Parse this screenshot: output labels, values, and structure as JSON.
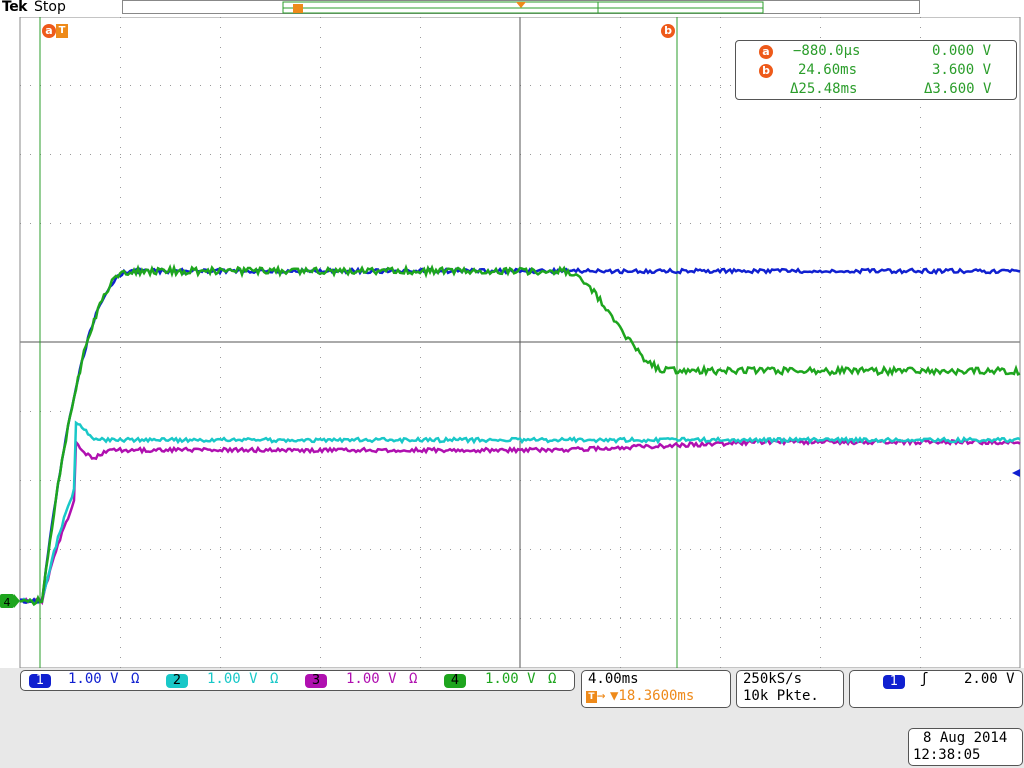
{
  "header": {
    "brand": "Tek",
    "status": "Stop"
  },
  "cursors": {
    "a_label": "a",
    "b_label": "b",
    "a_time": "−880.0µs",
    "a_volt": "0.000 V",
    "b_time": "24.60ms",
    "b_volt": "3.600 V",
    "delta_time": "Δ25.48ms",
    "delta_volt": "Δ3.600 V"
  },
  "channels": [
    {
      "num": "1",
      "scale": "1.00 V",
      "coupling": "Ω",
      "color": "#1020d0"
    },
    {
      "num": "2",
      "scale": "1.00 V",
      "coupling": "Ω",
      "color": "#19c8c8"
    },
    {
      "num": "3",
      "scale": "1.00 V",
      "coupling": "Ω",
      "color": "#b010b0"
    },
    {
      "num": "4",
      "scale": "1.00 V",
      "coupling": "Ω",
      "color": "#1ea51e"
    }
  ],
  "ground_marker": "4",
  "timebase": {
    "scale": "4.00ms",
    "trigger_pos": "▼18.3600ms"
  },
  "acquisition": {
    "rate": "250kS/s",
    "length": "10k Pkte."
  },
  "trigger": {
    "source": "1",
    "slope": "ʃ",
    "level": "2.00 V"
  },
  "datetime": {
    "date": "8 Aug 2014",
    "time": "12:38:05"
  },
  "colors": {
    "cursor": "#2b9d2b",
    "accent": "#ee5a1a",
    "bottom_bg": "#e8e8e8"
  }
}
